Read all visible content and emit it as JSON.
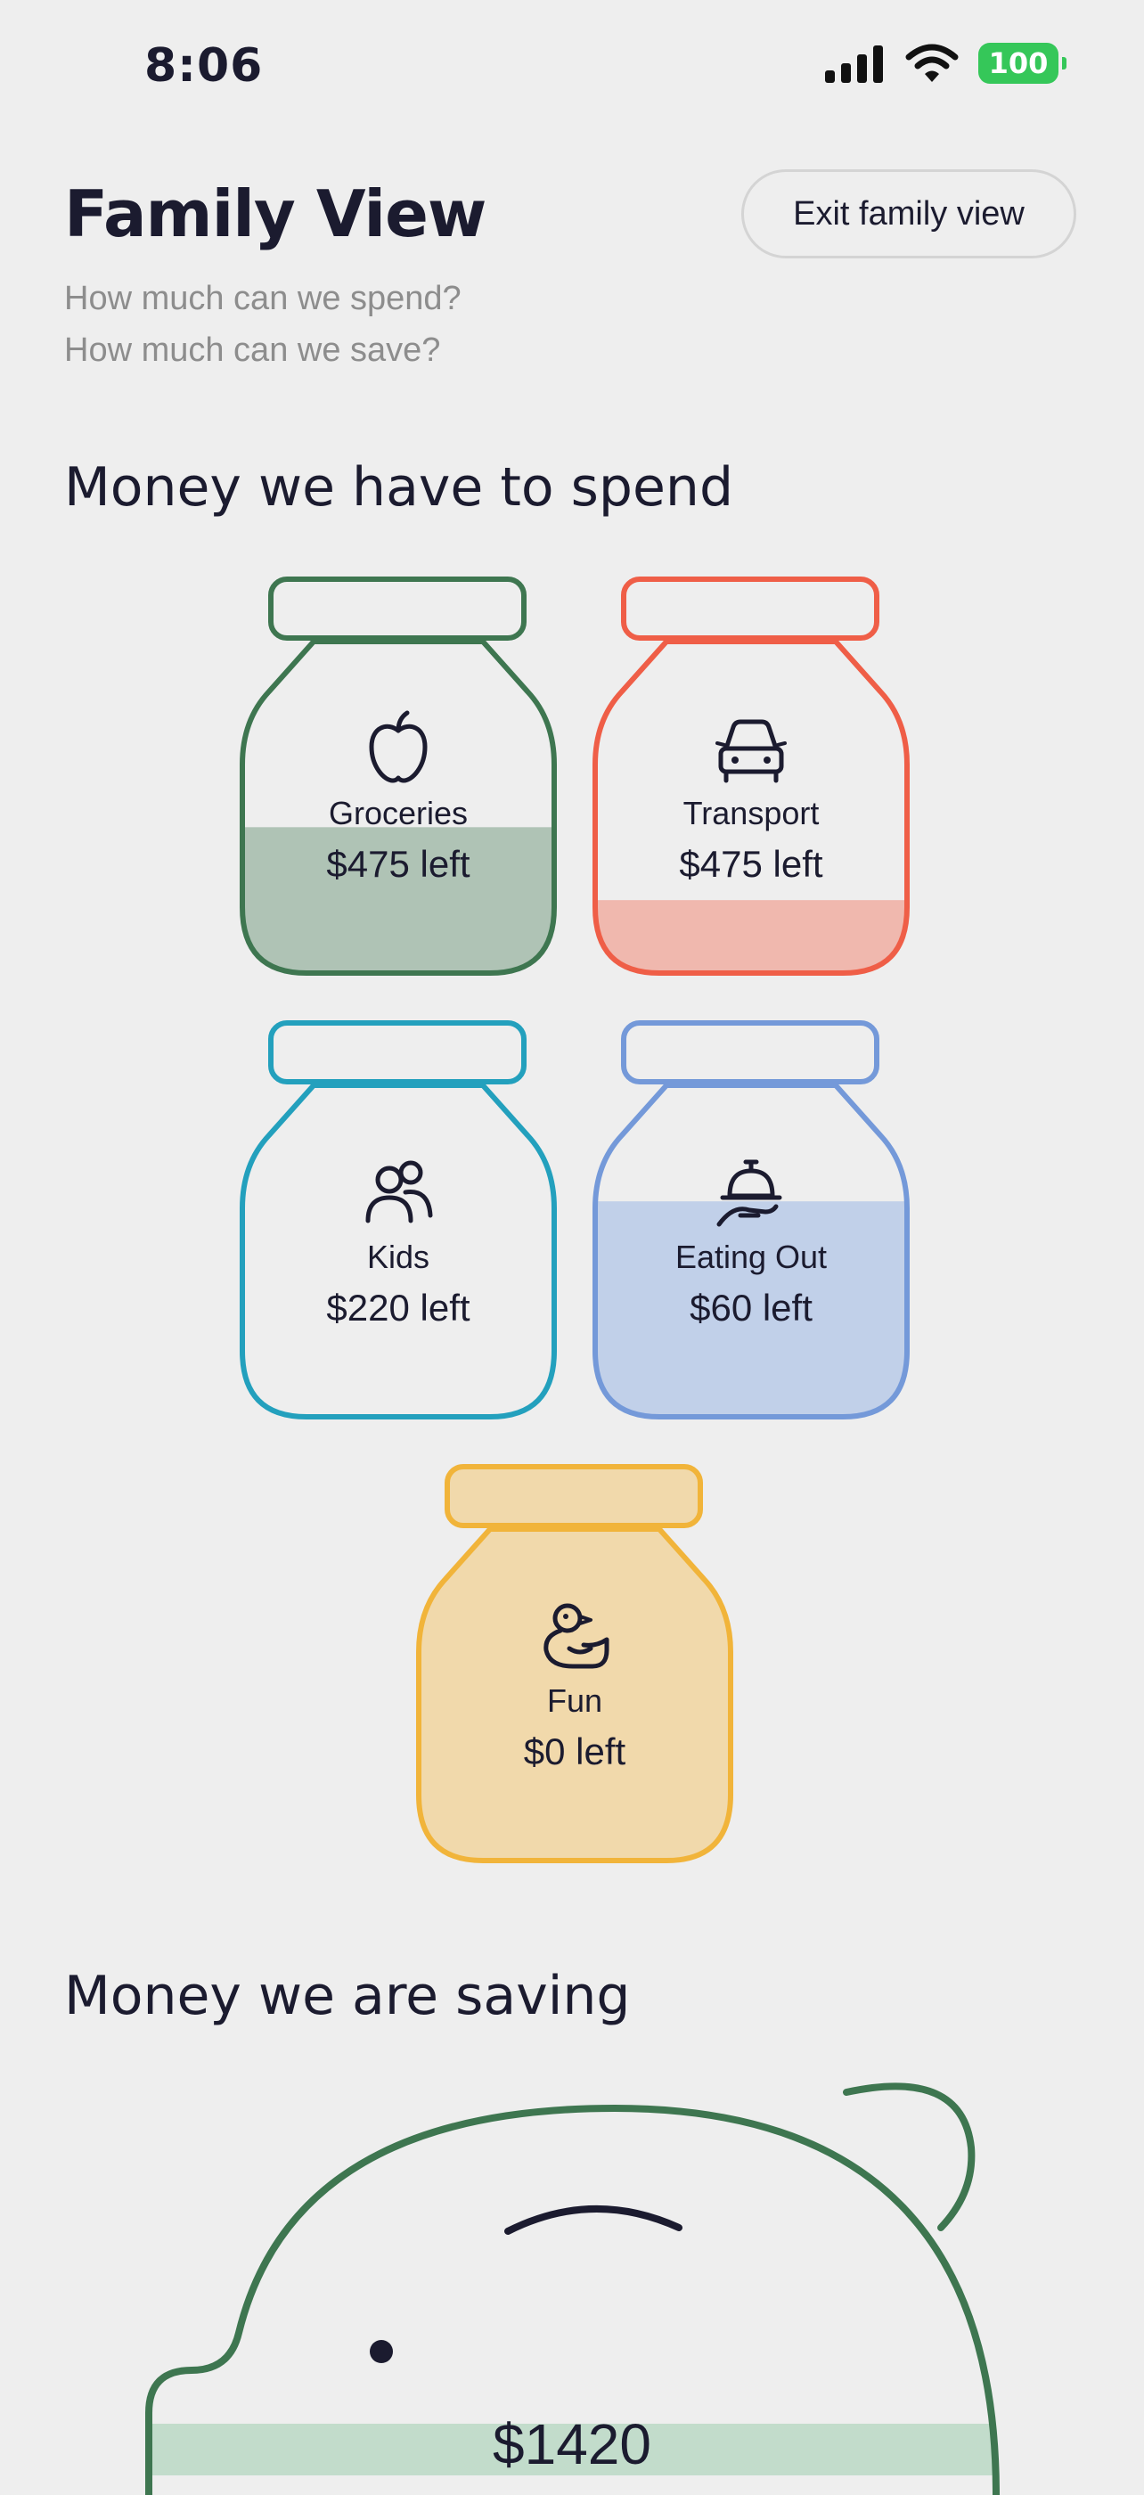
{
  "status_bar": {
    "time": "8:06",
    "battery": "100"
  },
  "header": {
    "title": "Family View",
    "exit_button": "Exit family view",
    "subtitle_line1": "How much can we spend?",
    "subtitle_line2": "How much can we save?"
  },
  "spend_section": {
    "title": "Money we have to spend",
    "jars": [
      {
        "label": "Groceries",
        "amount": "$475 left",
        "icon": "apple-icon",
        "color": "#3e7650",
        "fill_color": "#afc3b5",
        "fill_fraction": 0.44
      },
      {
        "label": "Transport",
        "amount": "$475 left",
        "icon": "car-icon",
        "color": "#ef5e47",
        "fill_color": "#f0b8ae",
        "fill_fraction": 0.22
      },
      {
        "label": "Kids",
        "amount": "$220 left",
        "icon": "people-icon",
        "color": "#23a0bd",
        "fill_color": "",
        "fill_fraction": 0
      },
      {
        "label": "Eating Out",
        "amount": "$60 left",
        "icon": "cloche-icon",
        "color": "#7499d9",
        "fill_color": "#c1d0e9",
        "fill_fraction": 0.65
      },
      {
        "label": "Fun",
        "amount": "$0 left",
        "icon": "duck-icon",
        "color": "#f1b43a",
        "fill_color": "#f1d9ab",
        "fill_fraction": 1.0
      }
    ]
  },
  "save_section": {
    "title": "Money we are saving",
    "amount": "$1420",
    "color": "#3e7650",
    "fill_color": "#c2dccb"
  }
}
